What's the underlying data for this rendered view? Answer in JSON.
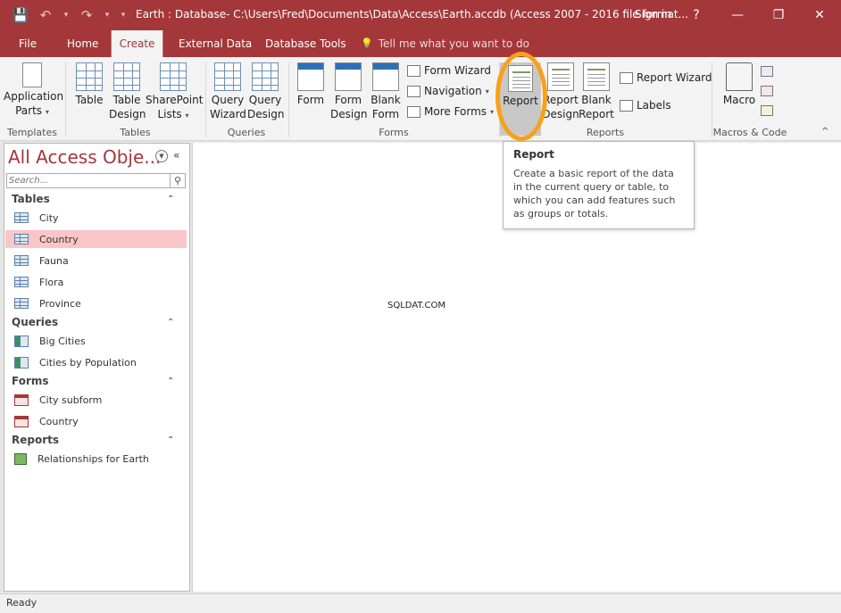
{
  "window": {
    "title": "Earth : Database- C:\\Users\\Fred\\Documents\\Data\\Access\\Earth.accdb (Access 2007 - 2016 file format...",
    "sign_in": "Sign in",
    "help": "?",
    "minimize": "—",
    "restore": "❐",
    "close": "✕"
  },
  "qat": {
    "save": "💾",
    "undo": "↶",
    "undo_menu": "▾",
    "redo": "↷",
    "redo_menu": "▾",
    "customize": "▾"
  },
  "tabs": [
    {
      "label": "File"
    },
    {
      "label": "Home"
    },
    {
      "label": "Create"
    },
    {
      "label": "External Data"
    },
    {
      "label": "Database Tools"
    }
  ],
  "tell_me": {
    "icon": "💡",
    "placeholder": "Tell me what you want to do"
  },
  "ribbon": {
    "templates": {
      "label": "Templates",
      "application_parts": [
        "Application",
        "Parts"
      ],
      "arrow": "▾"
    },
    "tables": {
      "label": "Tables",
      "table": [
        "Table",
        ""
      ],
      "table_design": [
        "Table",
        "Design"
      ],
      "sharepoint": [
        "SharePoint",
        "Lists"
      ],
      "arrow": "▾"
    },
    "queries": {
      "label": "Queries",
      "query_wizard": [
        "Query",
        "Wizard"
      ],
      "query_design": [
        "Query",
        "Design"
      ]
    },
    "forms": {
      "label": "Forms",
      "form": [
        "Form",
        ""
      ],
      "form_design": [
        "Form",
        "Design"
      ],
      "blank_form": [
        "Blank",
        "Form"
      ],
      "form_wizard": "Form Wizard",
      "navigation": "Navigation",
      "more_forms": "More Forms",
      "arrow": "▾"
    },
    "reports": {
      "label": "Reports",
      "report": "Report",
      "report_design": [
        "Report",
        "Design"
      ],
      "blank_report": [
        "Blank",
        "Report"
      ],
      "report_wizard": "Report Wizard",
      "labels": "Labels"
    },
    "macros": {
      "label": "Macros & Code",
      "macro": "Macro"
    },
    "collapse": "^"
  },
  "nav": {
    "title": "All Access Obje...",
    "menu_icon": "▼",
    "collapse_icon": "«",
    "search_placeholder": "Search...",
    "search_icon": "⚲",
    "categories": {
      "tables": {
        "label": "Tables",
        "toggle": "⌃",
        "items": [
          "City",
          "Country",
          "Fauna",
          "Flora",
          "Province"
        ]
      },
      "queries": {
        "label": "Queries",
        "toggle": "⌃",
        "items": [
          "Big Cities",
          "Cities by Population"
        ]
      },
      "forms": {
        "label": "Forms",
        "toggle": "⌃",
        "items": [
          "City subform",
          "Country"
        ]
      },
      "reports": {
        "label": "Reports",
        "toggle": "⌃",
        "items": [
          "Relationships for Earth"
        ]
      }
    }
  },
  "tooltip": {
    "title": "Report",
    "body": "Create a basic report of the data in the current query or table, to which you can add features such as groups or totals."
  },
  "watermark": "SQLDAT.COM",
  "status": {
    "text": "Ready"
  },
  "colors": {
    "accent": "#a4373a",
    "selection": "#fbc6c8",
    "highlight_ring": "#f7a11a"
  }
}
